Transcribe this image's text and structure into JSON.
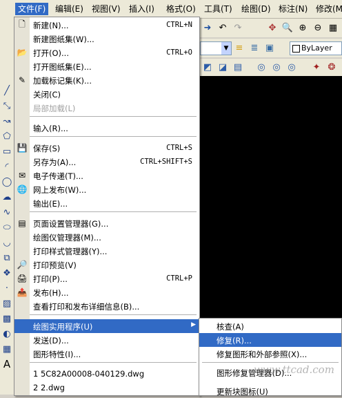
{
  "menubar": {
    "items": [
      "文件(F)",
      "编辑(E)",
      "视图(V)",
      "插入(I)",
      "格式(O)",
      "工具(T)",
      "绘图(D)",
      "标注(N)",
      "修改(M)"
    ]
  },
  "toolbar": {
    "layer_value": "ByLayer"
  },
  "file_menu": {
    "items": [
      {
        "label": "新建(N)...",
        "shortcut": "CTRL+N",
        "icon": "new-file-icon"
      },
      {
        "label": "新建图纸集(W)...",
        "shortcut": "",
        "icon": ""
      },
      {
        "label": "打开(O)...",
        "shortcut": "CTRL+O",
        "icon": "open-folder-icon"
      },
      {
        "label": "打开图纸集(E)...",
        "shortcut": "",
        "icon": ""
      },
      {
        "label": "加载标记集(K)...",
        "shortcut": "",
        "icon": "markup-icon"
      },
      {
        "label": "关闭(C)",
        "shortcut": "",
        "icon": ""
      },
      {
        "label": "局部加载(L)",
        "shortcut": "",
        "icon": "",
        "disabled": true
      },
      {
        "label": "输入(R)...",
        "shortcut": "",
        "icon": ""
      },
      {
        "label": "保存(S)",
        "shortcut": "CTRL+S",
        "icon": "save-icon"
      },
      {
        "label": "另存为(A)...",
        "shortcut": "CTRL+SHIFT+S",
        "icon": ""
      },
      {
        "label": "电子传递(T)...",
        "shortcut": "",
        "icon": "etransmit-icon"
      },
      {
        "label": "网上发布(W)...",
        "shortcut": "",
        "icon": "publish-web-icon"
      },
      {
        "label": "输出(E)...",
        "shortcut": "",
        "icon": ""
      },
      {
        "label": "页面设置管理器(G)...",
        "shortcut": "",
        "icon": "page-setup-icon"
      },
      {
        "label": "绘图仪管理器(M)...",
        "shortcut": "",
        "icon": ""
      },
      {
        "label": "打印样式管理器(Y)...",
        "shortcut": "",
        "icon": ""
      },
      {
        "label": "打印预览(V)",
        "shortcut": "",
        "icon": "print-preview-icon"
      },
      {
        "label": "打印(P)...",
        "shortcut": "CTRL+P",
        "icon": "print-icon"
      },
      {
        "label": "发布(H)...",
        "shortcut": "",
        "icon": "publish-icon"
      },
      {
        "label": "查看打印和发布详细信息(B)...",
        "shortcut": "",
        "icon": ""
      },
      {
        "label": "绘图实用程序(U)",
        "shortcut": "",
        "icon": "",
        "submenu": true
      },
      {
        "label": "发送(D)...",
        "shortcut": "",
        "icon": ""
      },
      {
        "label": "图形特性(I)...",
        "shortcut": "",
        "icon": ""
      },
      {
        "label": "1 5C82A00008-040129.dwg",
        "shortcut": "",
        "icon": ""
      },
      {
        "label": "2 2.dwg",
        "shortcut": "",
        "icon": ""
      }
    ]
  },
  "utilities_submenu": {
    "items": [
      {
        "label": "核查(A)"
      },
      {
        "label": "修复(R)..."
      },
      {
        "label": "修复图形和外部参照(X)..."
      },
      {
        "label": "图形修复管理器(D)..."
      },
      {
        "label": "更新块图标(U)"
      }
    ]
  },
  "watermark": "www.ttcad.com"
}
